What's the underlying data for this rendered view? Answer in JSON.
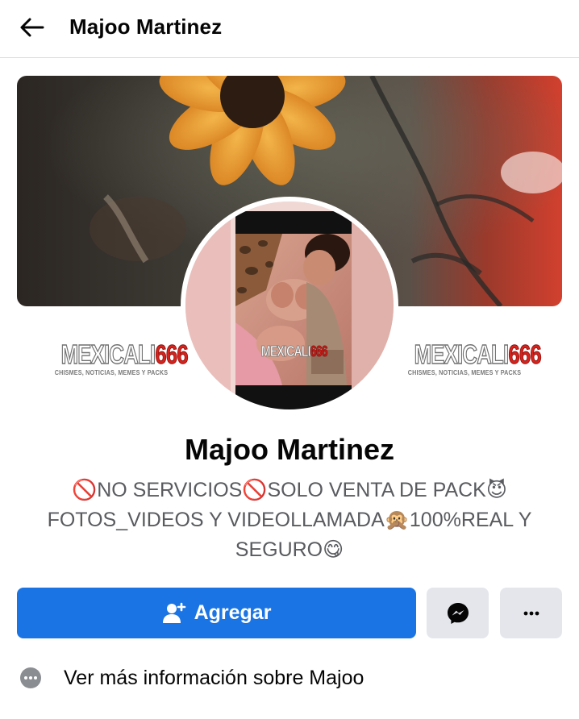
{
  "header": {
    "title": "Majoo Martinez",
    "back_icon": "arrow-left-icon"
  },
  "cover": {
    "watermark_left": {
      "logo_main": "MEXICALI",
      "logo_number": "666",
      "tagline": "CHISMES, NOTICIAS, MEMES Y PACKS"
    },
    "watermark_right": {
      "logo_main": "MEXICALI",
      "logo_number": "666",
      "tagline": "CHISMES, NOTICIAS, MEMES Y PACKS"
    }
  },
  "avatar": {
    "watermark": {
      "logo_main": "MEXICALI",
      "logo_number": "666"
    }
  },
  "profile": {
    "name": "Majoo Martinez",
    "bio_line1": "🚫NO SERVICIOS🚫SOLO VENTA DE PACK😈",
    "bio_line2": "FOTOS_VIDEOS Y VIDEOLLAMADA🙊100%REAL Y",
    "bio_line3": "SEGURO😋"
  },
  "actions": {
    "add_label": "Agregar",
    "add_icon": "user-plus-icon",
    "message_icon": "messenger-icon",
    "more_icon": "more-horizontal-icon"
  },
  "info": {
    "label": "Ver más información sobre Majoo",
    "icon": "more-info-icon"
  },
  "colors": {
    "primary_blue": "#1b74e4",
    "secondary_gray": "#e4e6eb",
    "text_primary": "#050505",
    "text_secondary": "#5a5b5f",
    "logo_red": "#d8231c"
  }
}
